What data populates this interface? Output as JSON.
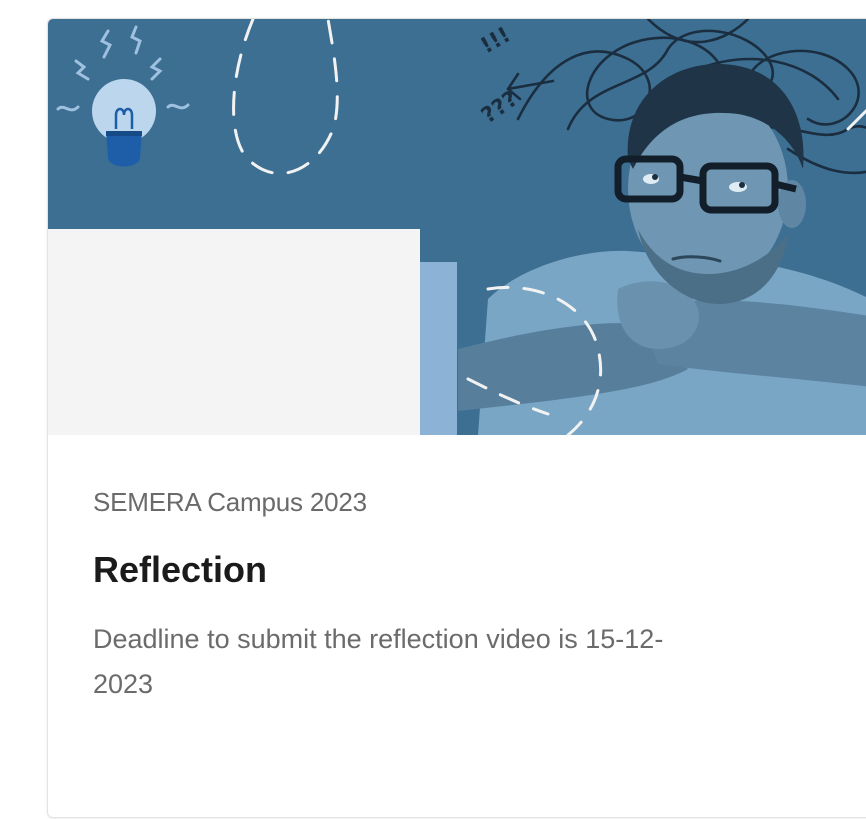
{
  "card": {
    "subtitle": "SEMERA Campus 2023",
    "title": "Reflection",
    "description": "Deadline to submit the reflection video is 15-12-2023",
    "banner": {
      "annotation_marks": "!!!",
      "question_marks": "???"
    }
  },
  "colors": {
    "banner_blue": "#3d6f93",
    "panel_white": "#f4f4f4",
    "panel_light_blue": "#8cb3d6",
    "bulb_glass": "#bcd6ee",
    "bulb_base": "#1e5ea8",
    "title_text": "#1b1b1b",
    "body_text": "#6b6b6b"
  },
  "icons": {
    "banner_icon": "light-bulb-icon"
  }
}
